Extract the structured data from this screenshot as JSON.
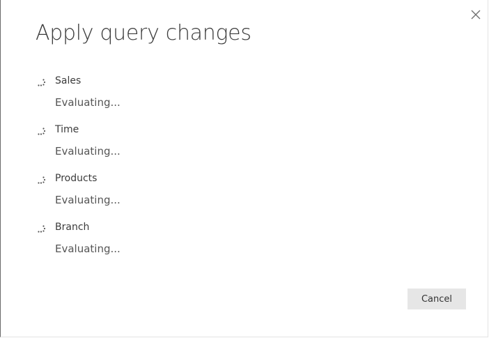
{
  "dialog": {
    "title": "Apply query changes",
    "close_icon": "close-icon",
    "queries": [
      {
        "name": "Sales",
        "status": "Evaluating...",
        "icon": "loading-spinner-icon"
      },
      {
        "name": "Time",
        "status": "Evaluating...",
        "icon": "loading-spinner-icon"
      },
      {
        "name": "Products",
        "status": "Evaluating...",
        "icon": "loading-spinner-icon"
      },
      {
        "name": "Branch",
        "status": "Evaluating...",
        "icon": "loading-spinner-icon"
      }
    ],
    "cancel_label": "Cancel"
  },
  "colors": {
    "title_text": "#3b3b3b",
    "status_text": "#555555",
    "button_bg": "#e6e6e6",
    "border_left": "#6a6a6a"
  }
}
